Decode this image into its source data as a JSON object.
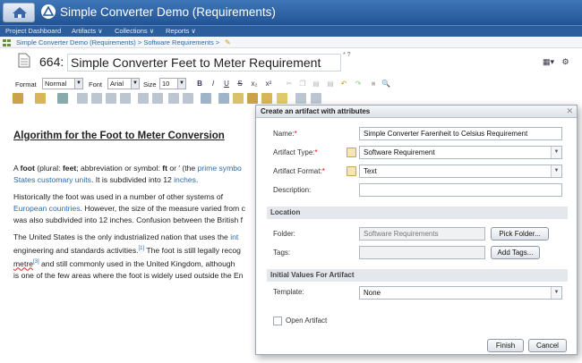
{
  "app": {
    "title": "Simple Converter Demo (Requirements)"
  },
  "nav": {
    "project_dashboard": "Project Dashboard",
    "artifacts": "Artifacts ∨",
    "collections": "Collections ∨",
    "reports": "Reports ∨"
  },
  "breadcrumb": "Simple Converter Demo (Requirements) > Software Requirements >",
  "artifact": {
    "id": "664:",
    "title": "Simple Converter Feet to Meter Requirement",
    "marks": "* ?"
  },
  "toolbar": {
    "format_label": "Format",
    "format_value": "Normal",
    "font_label": "Font",
    "font_value": "Arial",
    "size_label": "Size",
    "size_value": "10",
    "bold": "B",
    "italic": "I",
    "underline": "U",
    "strike": "S",
    "subscript": "x₂",
    "superscript": "x²"
  },
  "document": {
    "heading": "Algorithm for the Foot to Meter Conversion",
    "p1": {
      "a": "A ",
      "foot": "foot",
      "b": " (plural: ",
      "feet": "feet",
      "c": "; abbreviation or symbol: ",
      "ft": "ft",
      "d": " or ′ (the ",
      "link1": "prime symbo",
      "link2": "States customary units",
      "e": ". It is subdivided into 12 ",
      "link3": "inches",
      "f": "."
    },
    "p2": {
      "a": "Historically the foot was used in a number of other systems of",
      "link1": "European countries",
      "b": ". However, the size of the measure varied from c",
      "c": "was also subdivided into 12 inches. Confusion between the British f"
    },
    "p3": {
      "a": "The United States is the only industrialized nation that uses the ",
      "link1": "int",
      "b": "engineering and standards activities.",
      "sup1": "[1]",
      "c": " The foot is still legally recog",
      "squig": "metre",
      "sup3": "[3]",
      "d": " and still commonly used in the United Kingdom, although",
      "e": "is one of the few areas where the foot is widely used outside the En"
    }
  },
  "dialog": {
    "title": "Create an artifact with attributes",
    "name_label": "Name:",
    "name_value": "Simple Converter Farenheit to Celsius Requirement",
    "type_label": "Artifact Type:",
    "type_value": "Software Requirement",
    "format_label": "Artifact Format:",
    "format_value": "Text",
    "description_label": "Description:",
    "description_value": "",
    "location_section": "Location",
    "folder_label": "Folder:",
    "folder_value": "Software Requirements",
    "pick_folder": "Pick Folder...",
    "tags_label": "Tags:",
    "tags_value": "",
    "add_tags": "Add Tags...",
    "initial_section": "Initial Values For Artifact",
    "template_label": "Template:",
    "template_value": "None",
    "open_artifact": "Open Artifact",
    "finish": "Finish",
    "cancel": "Cancel",
    "required_mark": "*"
  }
}
